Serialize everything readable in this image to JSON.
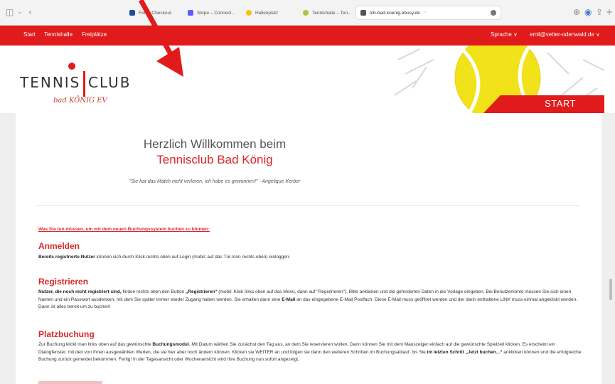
{
  "browser": {
    "tabs": [
      {
        "label": "Fertig Checkout"
      },
      {
        "label": "Stripe – Connect..."
      },
      {
        "label": "Hallenplatz"
      },
      {
        "label": "Tennishalle – Ten..."
      },
      {
        "label": "tcb-bad-koenig.ebusy.de"
      }
    ]
  },
  "nav": {
    "left": [
      "Start",
      "Tennishalle",
      "Freiplätze"
    ],
    "language": "Sprache ∨",
    "user": "emil@vetter-odenwald.de ∨"
  },
  "header": {
    "logo_tennis": "TENNIS",
    "logo_club": "CLUB",
    "logo_sub": "bad KÖNIG EV",
    "start": "START"
  },
  "welcome": {
    "line1": "Herzlich Willkommen beim",
    "line2": "Tennisclub Bad König",
    "quote": "\"Sie hat das Match nicht verloren, ich habe es gewonnen!\" - Angelique Kerber"
  },
  "intro": "Was Sie tun müssen, um mit dem neuen Buchungssystem buchen zu können:",
  "sections": {
    "anmelden": {
      "title": "Anmelden",
      "bold": "Bereits registrierte Nutzer",
      "text": " können sich durch Klick rechts oben auf Login (mobil: auf das Tür-Icon rechts oben) einloggen."
    },
    "registrieren": {
      "title": "Registrieren",
      "b1": "Nutzer, die noch nicht registriert sind,",
      "t1": " finden rechts oben den Button ",
      "b2": "„Registrieren“",
      "t2": " (mobil: Klick links oben auf das Menü, dann auf \"Registrieren\"). Bitte anklicken und die geforderten Daten in die Vorlage eingeben. Bei Benutzerkonto müssen Sie sich einen Namen und ein Passwort ausdenken, mit dem Sie später immer wieder Zugang haben werden. Sie erhalten dann eine ",
      "b3": "E-Mail",
      "t3": " an das eingegebene E-Mail Postfach. Diese E-Mail muss geöffnet werden und der darin enthaltene LINK muss einmal angeklickt werden. Dann ist alles bereit um zu buchen!"
    },
    "platzbuchung": {
      "title": "Platzbuchung",
      "t1": "Zur Buchung klickt man links oben auf das gewünschte ",
      "b1": "Buchungsmodul",
      "t2": ". Mit Datum wählen Sie zunächst den Tag aus, an dem Sie reservieren wollen. Dann können Sie mit dem Mauszeiger einfach auf die gewünschte Spielzeit klicken. Es erscheint ein Dialogfenster, mit den von Ihnen ausgewählten Werten, die sie hier aber noch ändern können. Klicken sie WEITER an und folgen sie dann den weiteren  Schritten im Buchungsablauf, bis Sie ",
      "b2": "im letzten Schritt „Jetzt buchen...“",
      "t3": " anklicken können und die erfolgreiche Buchung zurück gemeldet bekommen. Fertig! In der Tagesansicht oder Wochenansicht wird Ihre Buchung nun sofort angezeigt."
    }
  },
  "colors": {
    "brand_red": "#e11b1b",
    "heading_red": "#d9262b",
    "ball_yellow": "#f2e21a"
  }
}
